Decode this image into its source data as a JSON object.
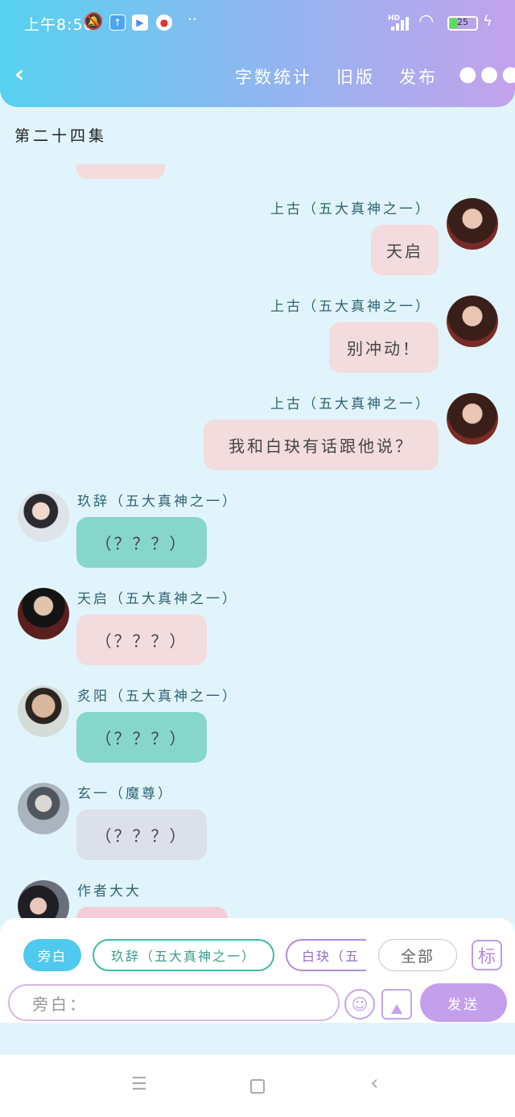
{
  "status_bar": {
    "time": "上午8:56",
    "battery": "25"
  },
  "header": {
    "back_icon": "chevron-left-icon",
    "word_count": "字数统计",
    "old_version": "旧版",
    "publish": "发布",
    "more_icon": "more-dots-icon"
  },
  "episode_title": "第二十四集",
  "messages": [
    {
      "side": "right",
      "name": "上古（五大真神之一）",
      "text": "天启",
      "color": "#f3dcdd"
    },
    {
      "side": "right",
      "name": "上古（五大真神之一）",
      "text": "别冲动！",
      "color": "#f3dcdd"
    },
    {
      "side": "right",
      "name": "上古（五大真神之一）",
      "text": "我和白玦有话跟他说？",
      "color": "#f3dcdd"
    },
    {
      "side": "left",
      "name": "玖辞（五大真神之一）",
      "text": "（？？？）",
      "color": "#86d6cc"
    },
    {
      "side": "left",
      "name": "天启（五大真神之一）",
      "text": "（？？？）",
      "color": "#f3dcdd"
    },
    {
      "side": "left",
      "name": "炙阳（五大真神之一）",
      "text": "（？？？）",
      "color": "#86d6cc"
    },
    {
      "side": "left",
      "name": "玄一（魔尊）",
      "text": "（？？？）",
      "color": "#dbe0ea"
    },
    {
      "side": "left",
      "name": "作者大大",
      "text": "",
      "color": "#f5cdd8"
    }
  ],
  "composer": {
    "chips": [
      "旁白",
      "玖辞（五大真神之一）",
      "白玦（五",
      "全部"
    ],
    "mark_label": "标",
    "input_placeholder": "旁白：",
    "emoji_icon": "emoji-wink-icon",
    "image_icon": "image-icon",
    "send_label": "发送"
  },
  "system_nav": {
    "menu_icon": "menu-icon",
    "home_icon": "home-square-icon",
    "back_icon": "back-triangle-icon"
  }
}
